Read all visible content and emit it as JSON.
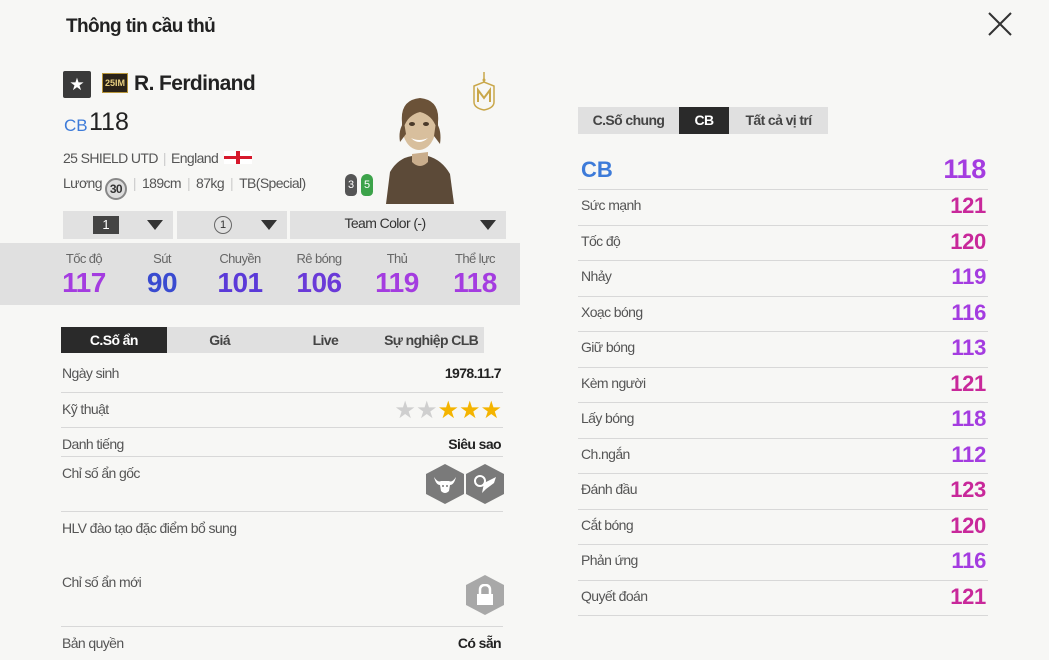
{
  "header": {
    "title": "Thông tin cầu thủ"
  },
  "player": {
    "season_badge": "25IM",
    "name": "R. Ferdinand",
    "position": "CB",
    "ovr": "118",
    "club": "25 SHIELD UTD",
    "nation": "England",
    "salary_label": "Lương",
    "salary": "30",
    "height": "189cm",
    "weight": "87kg",
    "body_type": "TB(Special)",
    "weak_foot_left": "3",
    "weak_foot_right": "5"
  },
  "selectors": {
    "level": "1",
    "skill": "1",
    "team_color": "Team Color (-)"
  },
  "main_stats": [
    {
      "label": "Tốc độ",
      "value": "117",
      "color": "#a43ce0"
    },
    {
      "label": "Sút",
      "value": "90",
      "color": "#3a4bd0"
    },
    {
      "label": "Chuyền",
      "value": "101",
      "color": "#5b3ad8"
    },
    {
      "label": "Rê bóng",
      "value": "106",
      "color": "#6a3ad8"
    },
    {
      "label": "Thủ",
      "value": "119",
      "color": "#a43ce0"
    },
    {
      "label": "Thể lực",
      "value": "118",
      "color": "#a43ce0"
    }
  ],
  "left_tabs": [
    "C.Số ẩn",
    "Giá",
    "Live",
    "Sự nghiệp CLB"
  ],
  "details": {
    "birth_label": "Ngày sinh",
    "birth": "1978.11.7",
    "skill_label": "Kỹ thuật",
    "skill_stars": 3,
    "reputation_label": "Danh tiếng",
    "reputation": "Siêu sao",
    "hidden_label": "Chỉ số ẩn gốc",
    "trainer_label": "HLV đào tạo đặc điểm bổ sung",
    "new_hidden_label": "Chỉ số ẩn mới",
    "license_label": "Bản quyền",
    "license": "Có sẵn"
  },
  "right_tabs": [
    "C.Số chung",
    "CB",
    "Tất cả vị trí"
  ],
  "position_rating": {
    "label": "CB",
    "value": "118",
    "label_color": "#3d7bd9",
    "value_color": "#a43ce0"
  },
  "attributes": [
    {
      "label": "Sức mạnh",
      "value": "121",
      "color": "#c8289a"
    },
    {
      "label": "Tốc độ",
      "value": "120",
      "color": "#c8289a"
    },
    {
      "label": "Nhảy",
      "value": "119",
      "color": "#a43ce0"
    },
    {
      "label": "Xoạc bóng",
      "value": "116",
      "color": "#a43ce0"
    },
    {
      "label": "Giữ bóng",
      "value": "113",
      "color": "#a43ce0"
    },
    {
      "label": "Kèm người",
      "value": "121",
      "color": "#c8289a"
    },
    {
      "label": "Lấy bóng",
      "value": "118",
      "color": "#a43ce0"
    },
    {
      "label": "Ch.ngắn",
      "value": "112",
      "color": "#a43ce0"
    },
    {
      "label": "Đánh đầu",
      "value": "123",
      "color": "#c8289a"
    },
    {
      "label": "Cắt bóng",
      "value": "120",
      "color": "#c8289a"
    },
    {
      "label": "Phản ứng",
      "value": "116",
      "color": "#a43ce0"
    },
    {
      "label": "Quyết đoán",
      "value": "121",
      "color": "#c8289a"
    }
  ]
}
